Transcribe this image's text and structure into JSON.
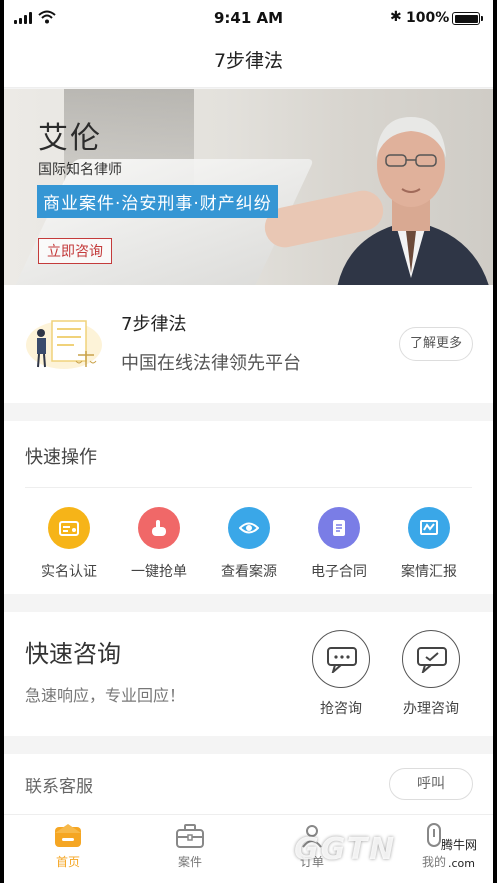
{
  "status_bar": {
    "time": "9:41 AM",
    "battery": "100%"
  },
  "nav": {
    "title": "7步律法"
  },
  "banner": {
    "name": "艾伦",
    "subtitle": "国际知名律师",
    "tags": "商业案件·治安刑事·财产纠纷",
    "button": "立即咨询"
  },
  "intro": {
    "title": "7步律法",
    "slogan": "中国在线法律领先平台",
    "more_button": "了解更多"
  },
  "quick_ops": {
    "header": "快速操作",
    "items": [
      {
        "label": "实名认证",
        "icon": "id-card-icon",
        "color": "#f6b418"
      },
      {
        "label": "一键抢单",
        "icon": "hand-tap-icon",
        "color": "#f06868"
      },
      {
        "label": "查看案源",
        "icon": "eye-icon",
        "color": "#3aa7e8"
      },
      {
        "label": "电子合同",
        "icon": "document-icon",
        "color": "#7a7de6"
      },
      {
        "label": "案情汇报",
        "icon": "report-icon",
        "color": "#3aa7e8"
      }
    ]
  },
  "quick_consult": {
    "header": "快速咨询",
    "subtitle": "急速响应，专业回应！",
    "buttons": [
      {
        "label": "抢咨询",
        "icon": "chat-icon"
      },
      {
        "label": "办理咨询",
        "icon": "chat-check-icon"
      }
    ]
  },
  "service": {
    "header": "联系客服",
    "call_button": "呼叫"
  },
  "tabbar": {
    "items": [
      {
        "label": "首页",
        "icon": "home-icon",
        "active": true
      },
      {
        "label": "案件",
        "icon": "briefcase-icon",
        "active": false
      },
      {
        "label": "订单",
        "icon": "order-icon",
        "active": false
      },
      {
        "label": "我的",
        "icon": "profile-icon",
        "active": false
      }
    ],
    "active_color": "#f5a623"
  },
  "watermark": {
    "logo": "GGTN",
    "name": "腾牛网",
    "domain": ".com"
  }
}
